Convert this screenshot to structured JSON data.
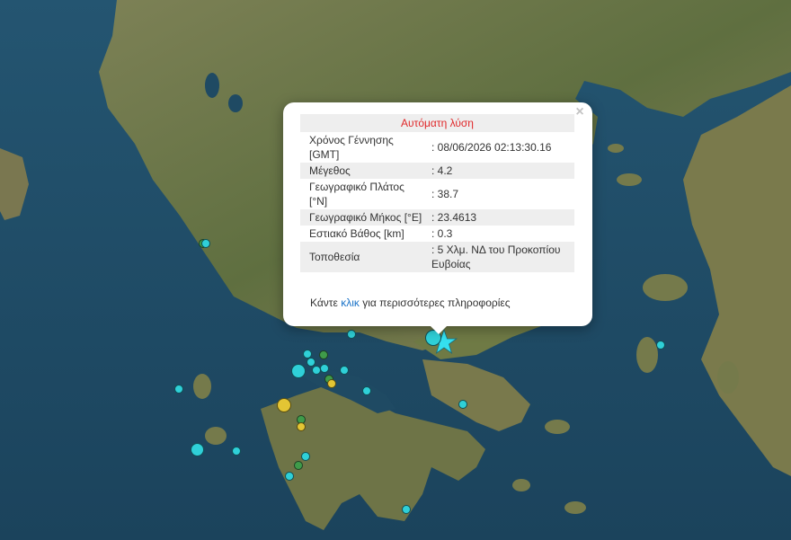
{
  "popup": {
    "title": "Αυτόματη λύση",
    "close_label": "×",
    "rows": [
      {
        "label": "Χρόνος Γέννησης [GMT]",
        "value": ": 08/06/2026 02:13:30.16"
      },
      {
        "label": "Μέγεθος",
        "value": ": 4.2"
      },
      {
        "label": "Γεωγραφικό Πλάτος [°N]",
        "value": ": 38.7"
      },
      {
        "label": "Γεωγραφικό Μήκος [°E]",
        "value": ": 23.4613"
      },
      {
        "label": "Εστιακό Βάθος [km]",
        "value": ": 0.3"
      },
      {
        "label": "Τοποθεσία",
        "value": ": 5 Χλμ. ΝΔ του Προκοπίου Ευβοίας"
      }
    ],
    "footer_prefix": "Κάντε ",
    "footer_link": "κλικ",
    "footer_suffix": " για περισσότερες πληροφορίες"
  },
  "colors": {
    "sea": "#1f4a63",
    "land": "#6b7a4a",
    "popup_title": "#e0282a",
    "marker_cyan": "#2fd0d8",
    "marker_green": "#3f9b4a",
    "marker_yellow": "#e3c534",
    "epicenter_star": "#35e0f0"
  },
  "epicenter_icon": "star-icon"
}
